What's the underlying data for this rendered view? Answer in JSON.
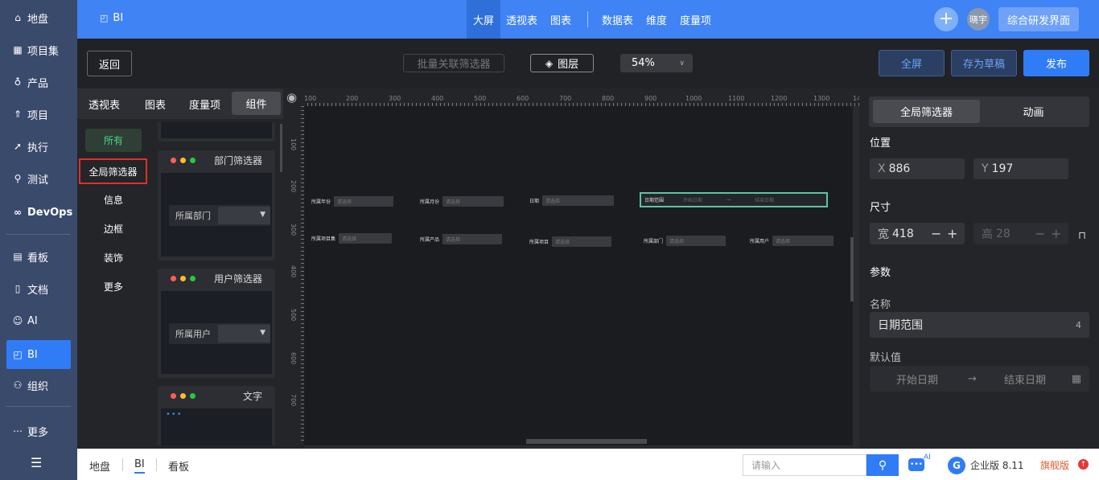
{
  "nav": {
    "items": [
      {
        "label": "地盘",
        "icon": "home-icon"
      },
      {
        "label": "项目集",
        "icon": "grid-icon"
      },
      {
        "label": "产品",
        "icon": "bulb-icon"
      },
      {
        "label": "项目",
        "icon": "rocket-icon"
      },
      {
        "label": "执行",
        "icon": "launch-icon"
      },
      {
        "label": "测试",
        "icon": "search-icon"
      },
      {
        "label": "DevOps",
        "icon": "infinity-icon"
      },
      {
        "label": "看板",
        "icon": "board-icon"
      },
      {
        "label": "文档",
        "icon": "doc-icon"
      },
      {
        "label": "AI",
        "icon": "robot-icon"
      },
      {
        "label": "BI",
        "icon": "bi-icon"
      },
      {
        "label": "组织",
        "icon": "people-icon"
      },
      {
        "label": "更多",
        "icon": "more-icon"
      }
    ]
  },
  "topbar": {
    "title": "BI",
    "tabs": [
      "大屏",
      "透视表",
      "图表",
      "数据表",
      "维度",
      "度量项"
    ],
    "user": "晓宇",
    "product_button": "综合研发界面"
  },
  "toolbar": {
    "back": "返回",
    "batch": "批量关联筛选器",
    "layers": "图层",
    "zoom": "54%",
    "fullscreen": "全屏",
    "save_draft": "存为草稿",
    "publish": "发布"
  },
  "left_panel": {
    "tabs": [
      "透视表",
      "图表",
      "度量项",
      "组件"
    ],
    "categories": [
      "所有",
      "全局筛选器",
      "信息",
      "边框",
      "装饰",
      "更多"
    ],
    "cards": [
      {
        "title": "部门筛选器",
        "label": "所属部门"
      },
      {
        "title": "用户筛选器",
        "label": "所属用户"
      },
      {
        "title": "文字"
      }
    ]
  },
  "canvas": {
    "ruler_x": [
      "100",
      "200",
      "300",
      "400",
      "500",
      "600",
      "700",
      "800",
      "900",
      "1000",
      "1100",
      "1200",
      "1300",
      "14"
    ],
    "ruler_y": [
      "100",
      "200",
      "300",
      "400",
      "500",
      "600",
      "700"
    ],
    "filters_row1": [
      {
        "label": "所属年份",
        "placeholder": "请选择"
      },
      {
        "label": "所属月份",
        "placeholder": "请选择"
      },
      {
        "label": "日期",
        "placeholder": "请选择"
      }
    ],
    "range": {
      "label": "日期范围",
      "start": "开始日期",
      "end": "结束日期"
    },
    "filters_row2": [
      {
        "label": "所属项目集",
        "placeholder": "请选择"
      },
      {
        "label": "所属产品",
        "placeholder": "请选择"
      },
      {
        "label": "所属项目",
        "placeholder": "请选择"
      },
      {
        "label": "所属部门",
        "placeholder": "请选择"
      },
      {
        "label": "所属用户",
        "placeholder": "请选择"
      }
    ]
  },
  "right_panel": {
    "tabs": [
      "全局筛选器",
      "动画"
    ],
    "position_label": "位置",
    "x_prefix": "X",
    "x": "886",
    "y_prefix": "Y",
    "y": "197",
    "size_label": "尺寸",
    "w_prefix": "宽",
    "w": "418",
    "h_prefix": "高",
    "h": "28",
    "params_label": "参数",
    "name_label": "名称",
    "name_value": "日期范围",
    "name_count": "4",
    "default_label": "默认值",
    "default_start": "开始日期",
    "default_end": "结束日期"
  },
  "bottom": {
    "links": [
      "地盘",
      "BI",
      "看板"
    ],
    "search_placeholder": "请输入",
    "ai_badge": "AI",
    "edition": "企业版 8.11",
    "flagship": "旗舰版"
  }
}
